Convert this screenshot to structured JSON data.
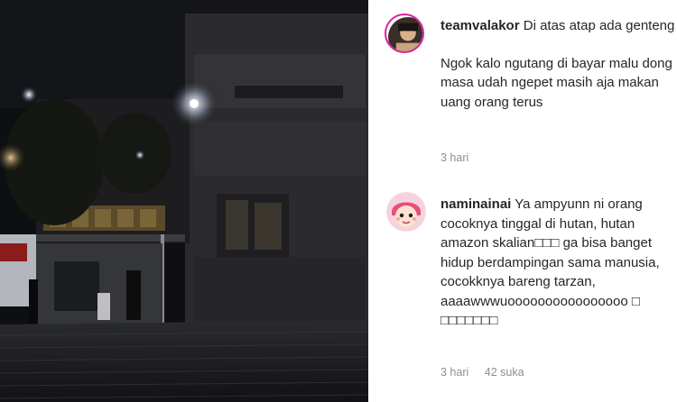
{
  "comments": [
    {
      "username": "teamvalakor",
      "text": "Di atas atap ada genteng",
      "text2": "Ngok kalo ngutang di bayar malu dong masa udah ngepet masih aja makan uang orang terus",
      "time": "3 hari",
      "avatar_icon": "profile-photo-icon"
    },
    {
      "username": "naminainai",
      "text": "Ya ampyunn ni orang cocoknya tinggal di hutan, hutan amazon skalian□□□ ga bisa banget hidup berdampingan sama manusia, cocokknya bareng tarzan,",
      "text2": "aaaawwwuoooooooooooooooo □ □□□□□□□",
      "time": "3 hari",
      "likes": "42 suka",
      "avatar_icon": "cartoon-girl-avatar-icon"
    }
  ],
  "colors": {
    "text": "#262626",
    "meta": "#8e8e8e",
    "avatar_ring": "#d6249f"
  }
}
